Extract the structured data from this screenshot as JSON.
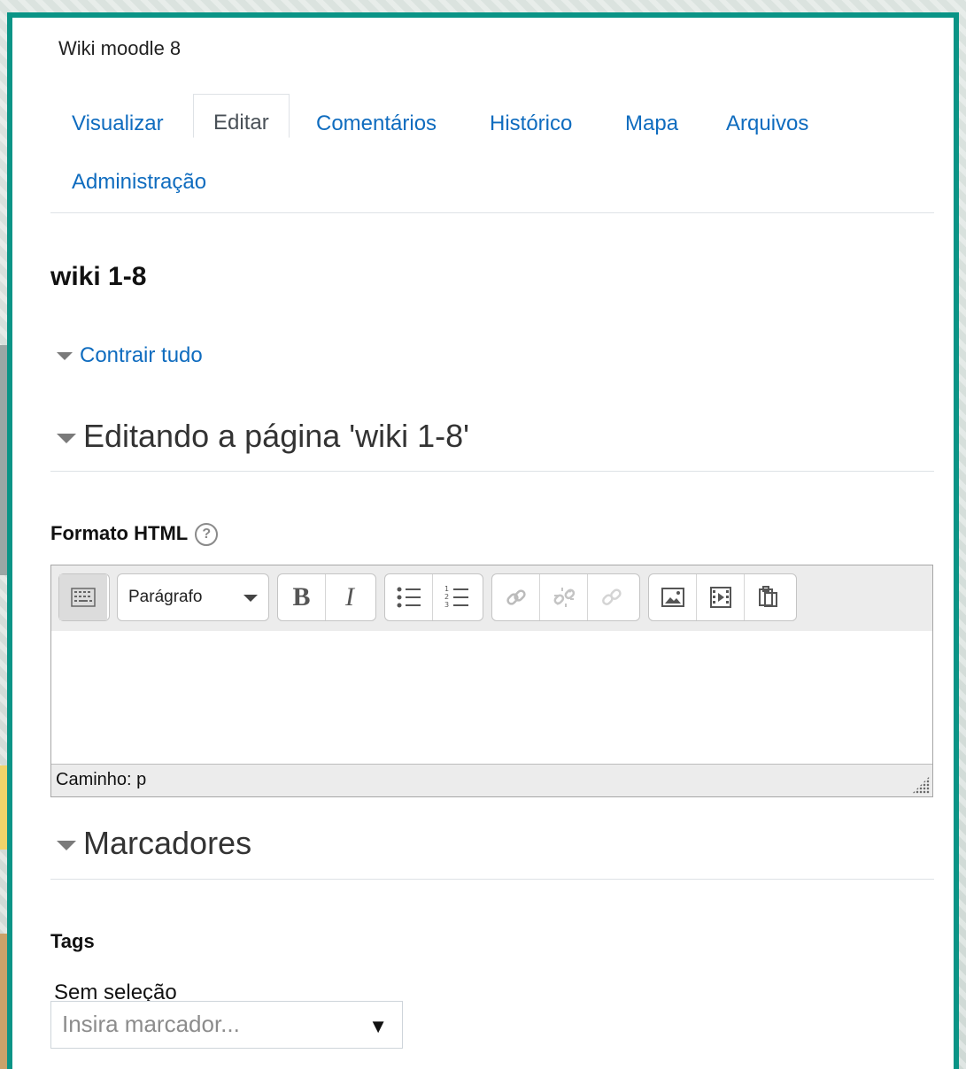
{
  "wiki": {
    "name": "Wiki moodle 8"
  },
  "tabs": [
    {
      "label": "Visualizar",
      "active": false
    },
    {
      "label": "Editar",
      "active": true
    },
    {
      "label": "Comentários",
      "active": false
    },
    {
      "label": "Histórico",
      "active": false
    },
    {
      "label": "Mapa",
      "active": false
    },
    {
      "label": "Arquivos",
      "active": false
    },
    {
      "label": "Administração",
      "active": false
    }
  ],
  "page_title": "wiki 1-8",
  "collapse_all": "Contrair tudo",
  "sections": {
    "editing": "Editando a página 'wiki 1-8'",
    "tags_section": "Marcadores"
  },
  "format_field": {
    "label": "Formato HTML",
    "help_icon": "question-circle-icon"
  },
  "editor": {
    "paragraph_select": "Parágrafo",
    "bold_glyph": "B",
    "italic_glyph": "I",
    "content": "",
    "path_label": "Caminho: p",
    "toolbar_icons": [
      "toolbar-toggle-icon",
      "bullet-list-icon",
      "numbered-list-icon",
      "link-icon",
      "unlink-icon",
      "manage-files-icon",
      "image-icon",
      "media-icon",
      "manage-files-paste-icon"
    ]
  },
  "tags": {
    "label": "Tags",
    "selection_status": "Sem seleção",
    "placeholder": "Insira marcador...",
    "dropdown_glyph": "▼"
  },
  "colors": {
    "frame": "#0a9486",
    "link": "#0f6cbf",
    "toolbar_bg": "#ececec"
  }
}
